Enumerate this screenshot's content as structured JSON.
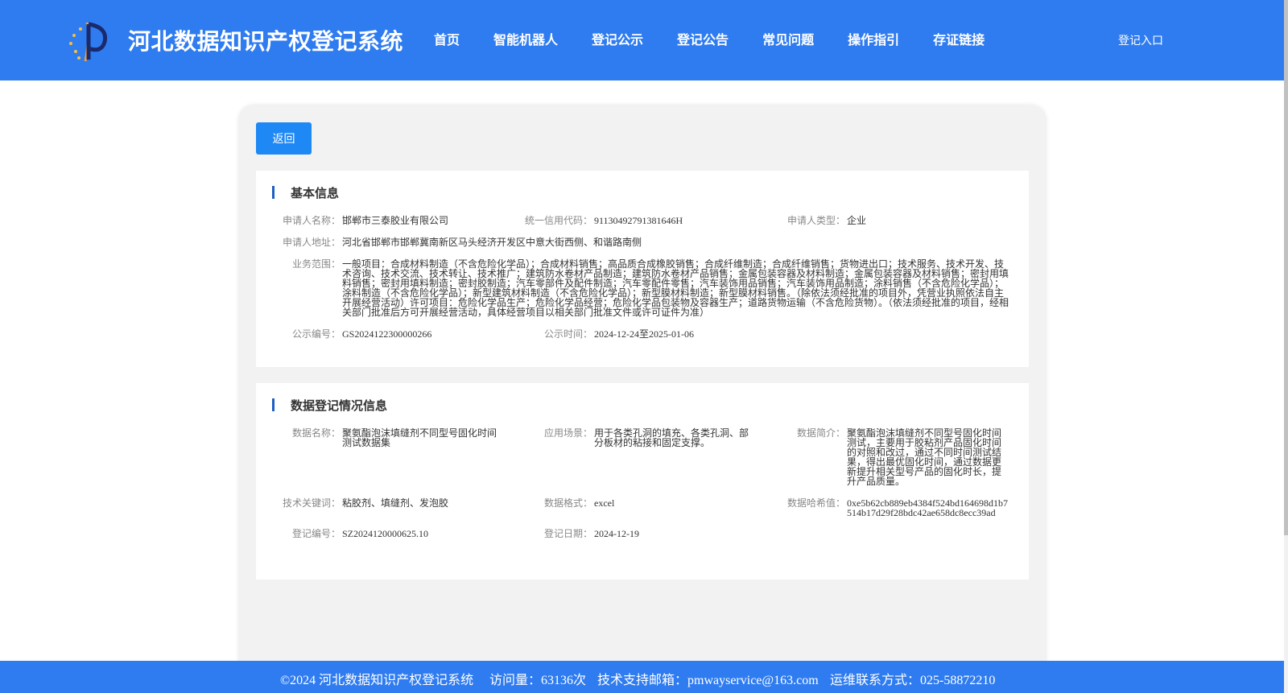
{
  "header": {
    "site_title": "河北数据知识产权登记系统",
    "nav": [
      "首页",
      "智能机器人",
      "登记公示",
      "登记公告",
      "常见问题",
      "操作指引",
      "存证链接"
    ],
    "login_label": "登记入口"
  },
  "back_label": "返回",
  "basic": {
    "title": "基本信息",
    "applicant_name_label": "申请人名称：",
    "applicant_name": "邯郸市三泰胶业有限公司",
    "credit_code_label": "统一信用代码：",
    "credit_code": "91130492791381646H",
    "applicant_type_label": "申请人类型：",
    "applicant_type": "企业",
    "address_label": "申请人地址：",
    "address": "河北省邯郸市邯郸冀南新区马头经济开发区中意大街西侧、和谐路南侧",
    "scope_label": "业务范围：",
    "scope": "一般项目：合成材料制造（不含危险化学品）；合成材料销售；高品质合成橡胶销售；合成纤维制造；合成纤维销售；货物进出口；技术服务、技术开发、技术咨询、技术交流、技术转让、技术推广；建筑防水卷材产品制造；建筑防水卷材产品销售；金属包装容器及材料制造；金属包装容器及材料销售；密封用填料销售；密封用填料制造；密封胶制造；汽车零部件及配件制造；汽车零配件零售；汽车装饰用品销售；汽车装饰用品制造；涂料销售（不含危险化学品）；涂料制造（不含危险化学品）；新型建筑材料制造（不含危险化学品）；新型膜材料制造；新型膜材料销售。（除依法须经批准的项目外，凭营业执照依法自主开展经营活动）许可项目：危险化学品生产；危险化学品经营；危险化学品包装物及容器生产；道路货物运输（不含危险货物）。（依法须经批准的项目，经相关部门批准后方可开展经营活动，具体经营项目以相关部门批准文件或许可证件为准）",
    "notice_no_label": "公示编号：",
    "notice_no": "GS2024122300000266",
    "notice_time_label": "公示时间：",
    "notice_time": "2024-12-24至2025-01-06"
  },
  "registration": {
    "title": "数据登记情况信息",
    "data_name_label": "数据名称：",
    "data_name": "聚氨酯泡沫填缝剂不同型号固化时间测试数据集",
    "scenario_label": "应用场景：",
    "scenario": "用于各类孔洞的填充、各类孔洞、部分板材的粘接和固定支撑。",
    "intro_label": "数据简介：",
    "intro": "聚氨酯泡沫填缝剂不同型号固化时间测试，主要用于胶粘剂产品固化时间的对照和改过，通过不同时间测试结果，得出最优固化时间，通过数据更新提升相关型号产品的固化时长，提升产品质量。",
    "keywords_label": "技术关键词：",
    "keywords": "粘胶剂、填缝剂、发泡胶",
    "format_label": "数据格式：",
    "format": "excel",
    "hash_label": "数据哈希值：",
    "hash": "0xe5b62cb889eb4384f524bd164698d1b7514b17d29f28bdc42ae658dc8ecc39ad",
    "reg_no_label": "登记编号：",
    "reg_no": "SZ2024120000625.10",
    "reg_date_label": "登记日期：",
    "reg_date": "2024-12-19"
  },
  "footer": {
    "copyright": "©2024 河北数据知识产权登记系统",
    "visits": "访问量：63136次",
    "email": "技术支持邮箱：pmwayservice@163.com",
    "phone": "运维联系方式：025-58872210"
  },
  "colors": {
    "header_bg": "#2f7cf0",
    "button_bg": "#1e88f5",
    "title_bar": "#1e5fc4"
  }
}
